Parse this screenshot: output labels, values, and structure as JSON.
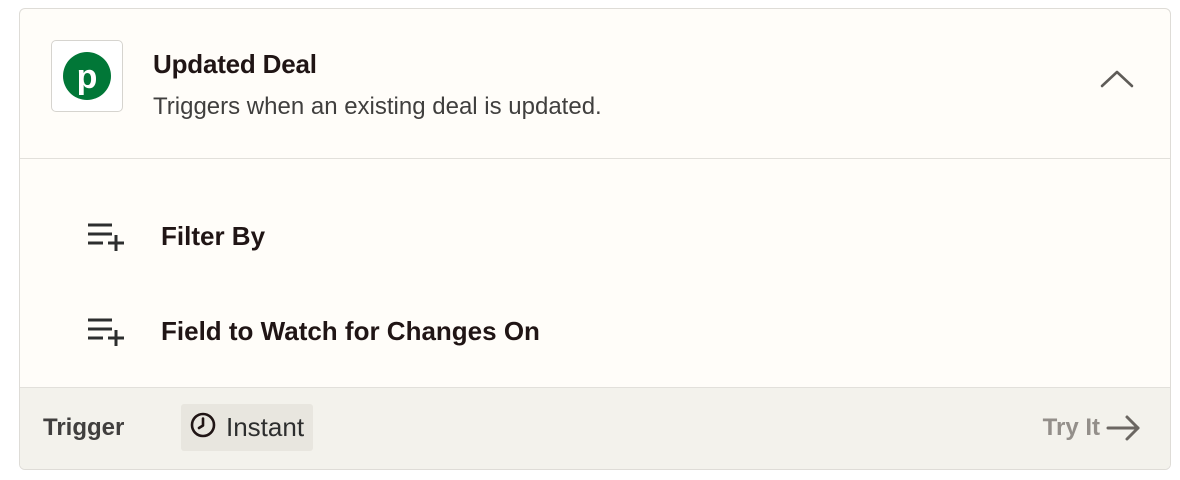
{
  "step": {
    "app_icon": "pipedrive-logo",
    "app_icon_letter": "p",
    "title": "Updated Deal",
    "description": "Triggers when an existing deal is updated.",
    "collapse_icon": "chevron-up-icon"
  },
  "options": [
    {
      "icon": "playlist-add-icon",
      "label": "Filter By"
    },
    {
      "icon": "playlist-add-icon",
      "label": "Field to Watch for Changes On"
    }
  ],
  "footer": {
    "type_label": "Trigger",
    "badge_icon": "clock-icon",
    "badge_label": "Instant",
    "try_label": "Try It",
    "try_icon": "arrow-right-icon"
  },
  "colors": {
    "brand_green": "#017737",
    "footer_bg": "#f3f2ec",
    "muted_text": "#938f8a"
  }
}
